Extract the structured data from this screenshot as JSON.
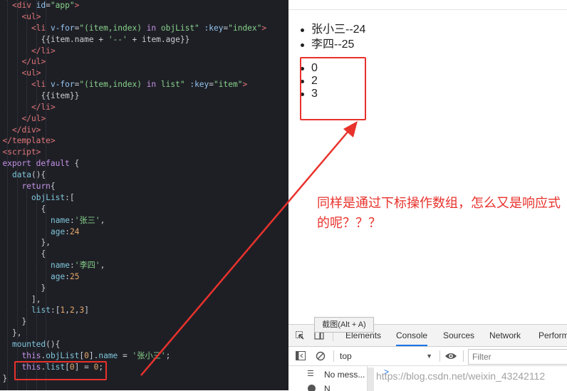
{
  "editor": {
    "lines": [
      [
        [
          "tag",
          "<div "
        ],
        [
          "attr",
          "id"
        ],
        [
          "punc",
          "="
        ],
        [
          "str",
          "\"app\""
        ],
        [
          "tag",
          ">"
        ]
      ],
      [
        [
          "tag",
          "<ul>"
        ]
      ],
      [
        [
          "tag",
          "<li "
        ],
        [
          "attr",
          "v-for"
        ],
        [
          "punc",
          "="
        ],
        [
          "str",
          "\"(item,index) "
        ],
        [
          "kw",
          "in"
        ],
        [
          "str",
          " objList\" "
        ],
        [
          "attr",
          ":key"
        ],
        [
          "punc",
          "="
        ],
        [
          "str",
          "\"index\""
        ],
        [
          "tag",
          ">"
        ]
      ],
      [
        [
          "punc",
          "{{item.name "
        ],
        [
          "punc",
          "+ "
        ],
        [
          "str",
          "'--'"
        ],
        [
          "punc",
          " + item.age}}"
        ]
      ],
      [
        [
          "tag",
          "</li>"
        ]
      ],
      [
        [
          "tag",
          "</ul>"
        ]
      ],
      [
        [
          "tag",
          "<ul>"
        ]
      ],
      [
        [
          "tag",
          "<li "
        ],
        [
          "attr",
          "v-for"
        ],
        [
          "punc",
          "="
        ],
        [
          "str",
          "\"(item,index) "
        ],
        [
          "kw",
          "in"
        ],
        [
          "str",
          " list\" "
        ],
        [
          "attr",
          ":key"
        ],
        [
          "punc",
          "="
        ],
        [
          "str",
          "\"item\""
        ],
        [
          "tag",
          ">"
        ]
      ],
      [
        [
          "punc",
          "{{item}}"
        ]
      ],
      [
        [
          "tag",
          "</li>"
        ]
      ],
      [
        [
          "tag",
          "</ul>"
        ]
      ],
      [
        [
          "tag",
          "</div>"
        ]
      ],
      [
        [
          "tag",
          "</template>"
        ]
      ],
      [
        [
          "tag",
          "<script>"
        ]
      ],
      [
        [
          "kw",
          "export default "
        ],
        [
          "punc",
          "{"
        ]
      ],
      [
        [
          "prop",
          "data"
        ],
        [
          "punc",
          "(){"
        ]
      ],
      [
        [
          "kw",
          "return"
        ],
        [
          "punc",
          "{"
        ]
      ],
      [
        [
          "prop",
          "objList"
        ],
        [
          "punc",
          ":["
        ]
      ],
      [
        [
          "punc",
          "{"
        ]
      ],
      [
        [
          "prop",
          "name"
        ],
        [
          "punc",
          ":"
        ],
        [
          "str",
          "'张三'"
        ],
        [
          "punc",
          ","
        ]
      ],
      [
        [
          "prop",
          "age"
        ],
        [
          "punc",
          ":"
        ],
        [
          "num",
          "24"
        ]
      ],
      [
        [
          "punc",
          "},"
        ]
      ],
      [
        [
          "punc",
          "{"
        ]
      ],
      [
        [
          "prop",
          "name"
        ],
        [
          "punc",
          ":"
        ],
        [
          "str",
          "'李四'"
        ],
        [
          "punc",
          ","
        ]
      ],
      [
        [
          "prop",
          "age"
        ],
        [
          "punc",
          ":"
        ],
        [
          "num",
          "25"
        ]
      ],
      [
        [
          "punc",
          "}"
        ]
      ],
      [
        [
          "punc",
          "],"
        ]
      ],
      [
        [
          "prop",
          "list"
        ],
        [
          "punc",
          ":["
        ],
        [
          "num",
          "1"
        ],
        [
          "punc",
          ","
        ],
        [
          "num",
          "2"
        ],
        [
          "punc",
          ","
        ],
        [
          "num",
          "3"
        ],
        [
          "punc",
          "]"
        ]
      ],
      [
        [
          "punc",
          "}"
        ]
      ],
      [
        [
          "punc",
          "},"
        ]
      ],
      [
        [
          "prop",
          "mounted"
        ],
        [
          "punc",
          "(){"
        ]
      ],
      [
        [
          "kw",
          "this"
        ],
        [
          "punc",
          "."
        ],
        [
          "prop",
          "objList"
        ],
        [
          "punc",
          "["
        ],
        [
          "num",
          "0"
        ],
        [
          "punc",
          "]."
        ],
        [
          "prop",
          "name"
        ],
        [
          "punc",
          " = "
        ],
        [
          "str",
          "'张小三'"
        ],
        [
          "punc",
          ";"
        ]
      ],
      [
        [
          "kw",
          "this"
        ],
        [
          "punc",
          "."
        ],
        [
          "prop",
          "list"
        ],
        [
          "punc",
          "["
        ],
        [
          "num",
          "0"
        ],
        [
          "punc",
          "] = "
        ],
        [
          "num",
          "0"
        ],
        [
          "punc",
          ";"
        ]
      ],
      [
        [
          "punc",
          "}"
        ]
      ]
    ]
  },
  "page": {
    "obj_items": [
      "张小三--24",
      "李四--25"
    ],
    "list_items": [
      "0",
      "2",
      "3"
    ]
  },
  "annotation": {
    "text": "同样是通过下标操作数组，怎么又是响应式的呢？？？",
    "color": "#e8322c"
  },
  "tooltip": "截图(Alt + A)",
  "devtools": {
    "tabs": [
      "Elements",
      "Console",
      "Sources",
      "Network",
      "Perform"
    ],
    "active_tab": "Console",
    "context": "top",
    "filter_placeholder": "Filter",
    "messages_label": "No mess...",
    "prompt": ">"
  },
  "watermark": "https://blog.csdn.net/weixin_43242112",
  "colors": {
    "accent": "#1a73e8",
    "annotation": "#e8322c",
    "editor_bg": "#1e1f25"
  }
}
